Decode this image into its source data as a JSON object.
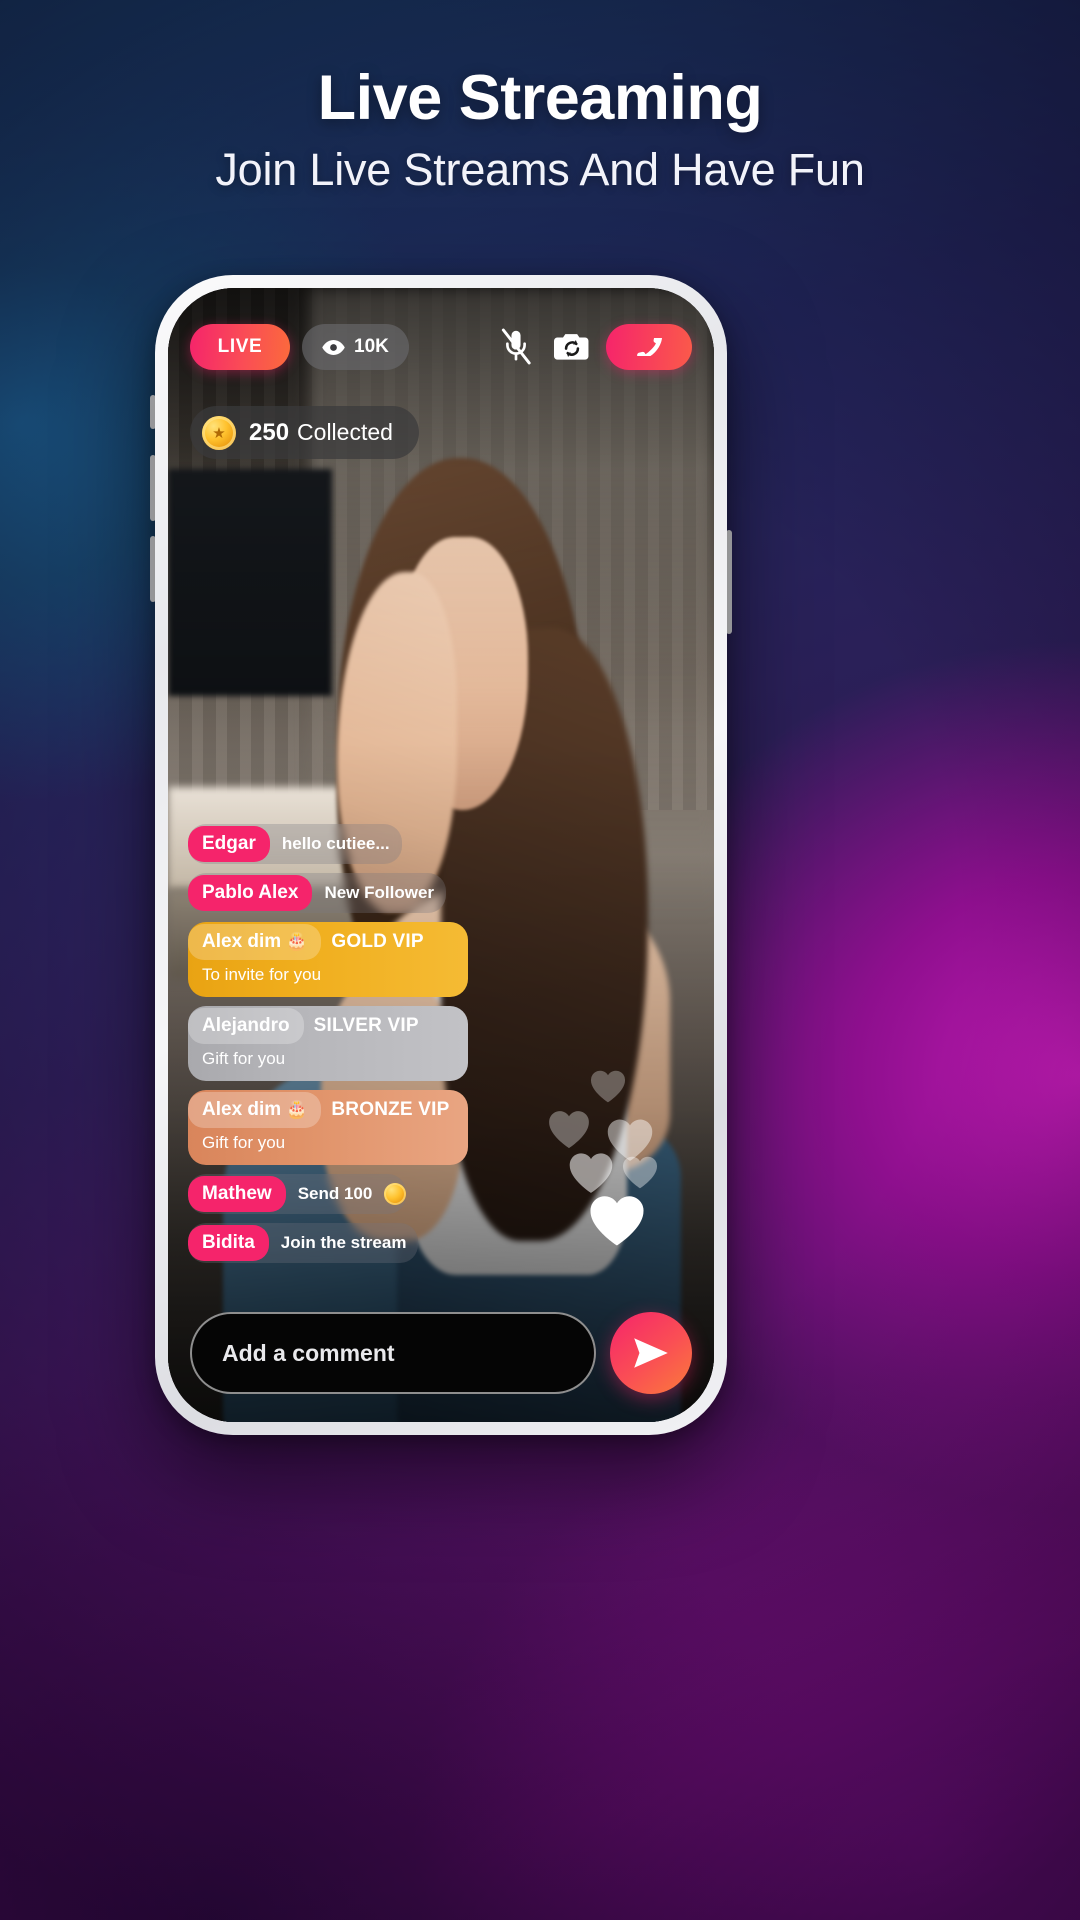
{
  "header": {
    "title": "Live Streaming",
    "subtitle": "Join Live Streams And Have Fun"
  },
  "stream": {
    "live_label": "LIVE",
    "viewer_count": "10K",
    "eye_icon": "eye-icon",
    "mic_icon": "mic-off-icon",
    "camera_icon": "camera-flip-icon",
    "hangup_icon": "end-call-icon",
    "coins": {
      "amount": "250",
      "label": "Collected",
      "icon": "coin-icon"
    },
    "messages": [
      {
        "name": "Edgar",
        "emoji": "",
        "text": "hello cutiee...",
        "sub": "",
        "tier": "plain",
        "tier_label": "",
        "coin": false
      },
      {
        "name": "Pablo Alex",
        "emoji": "",
        "text": "New Follower",
        "sub": "",
        "tier": "plain",
        "tier_label": "",
        "coin": false
      },
      {
        "name": "Alex dim",
        "emoji": "🎂",
        "text": "",
        "sub": "To invite for you",
        "tier": "gold",
        "tier_label": "GOLD VIP",
        "coin": false
      },
      {
        "name": "Alejandro",
        "emoji": "",
        "text": "",
        "sub": "Gift for you",
        "tier": "silver",
        "tier_label": "SILVER VIP",
        "coin": false
      },
      {
        "name": "Alex dim",
        "emoji": "🎂",
        "text": "",
        "sub": "Gift for you",
        "tier": "bronze",
        "tier_label": "BRONZE VIP",
        "coin": false
      },
      {
        "name": "Mathew",
        "emoji": "",
        "text": "Send 100",
        "sub": "",
        "tier": "plain",
        "tier_label": "",
        "coin": true
      },
      {
        "name": "Bidita",
        "emoji": "",
        "text": "Join the stream",
        "sub": "",
        "tier": "plain",
        "tier_label": "",
        "coin": false
      }
    ],
    "comment": {
      "placeholder": "Add a comment",
      "value": "",
      "send_icon": "send-icon"
    },
    "hearts_icon": "heart-icon"
  },
  "colors": {
    "accent_pink": "#f5246b",
    "accent_orange": "#fb6a3c",
    "gold": "#eca914",
    "silver": "#b6b6ba",
    "bronze": "#e09268"
  }
}
